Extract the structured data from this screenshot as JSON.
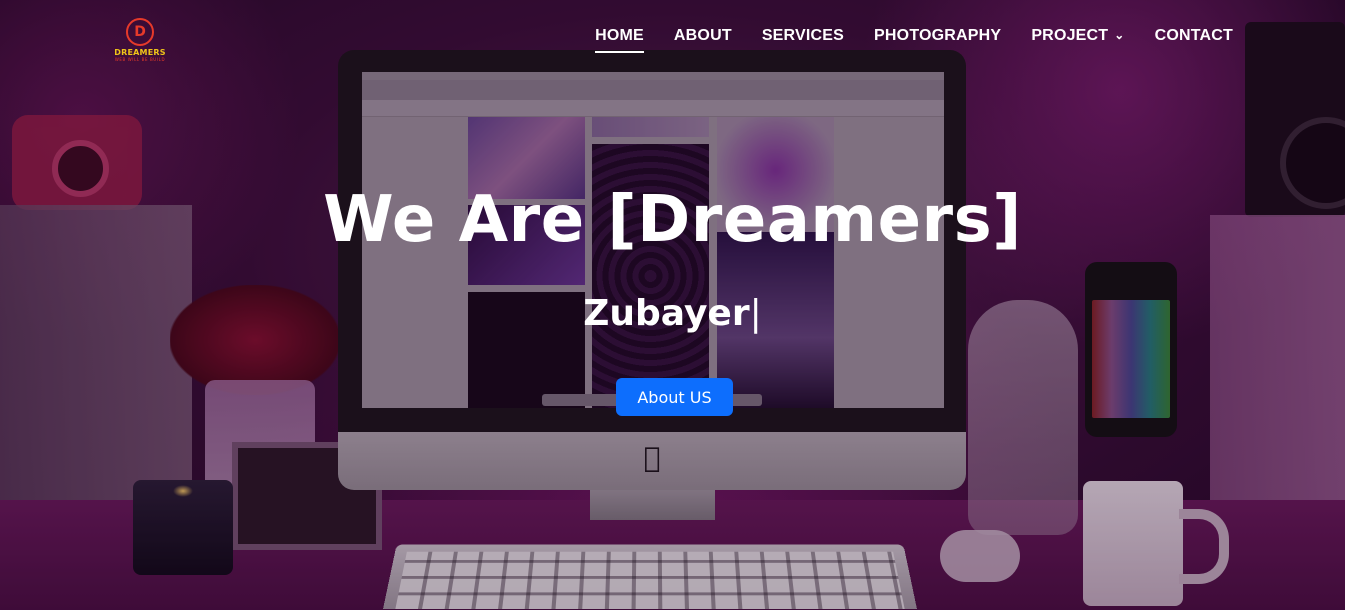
{
  "brand": {
    "name": "DREAMERS",
    "tagline": "WEB WILL BE BUILD",
    "mark": "D",
    "colors": {
      "primary": "#e63a2a",
      "secondary": "#f0c419"
    }
  },
  "nav": {
    "items": [
      {
        "label": "HOME",
        "active": true
      },
      {
        "label": "ABOUT",
        "active": false
      },
      {
        "label": "SERVICES",
        "active": false
      },
      {
        "label": "PHOTOGRAPHY",
        "active": false
      },
      {
        "label": "PROJECT",
        "active": false,
        "dropdown": true
      },
      {
        "label": "CONTACT",
        "active": false
      }
    ]
  },
  "hero": {
    "title": "We Are [Dreamers]",
    "typed_text": "Zubayer",
    "cursor": "|",
    "button_label": "About US",
    "button_color": "#0d6efd"
  },
  "background": {
    "description_icons": [
      "apple-logo-icon",
      "chevron-down-icon"
    ]
  }
}
